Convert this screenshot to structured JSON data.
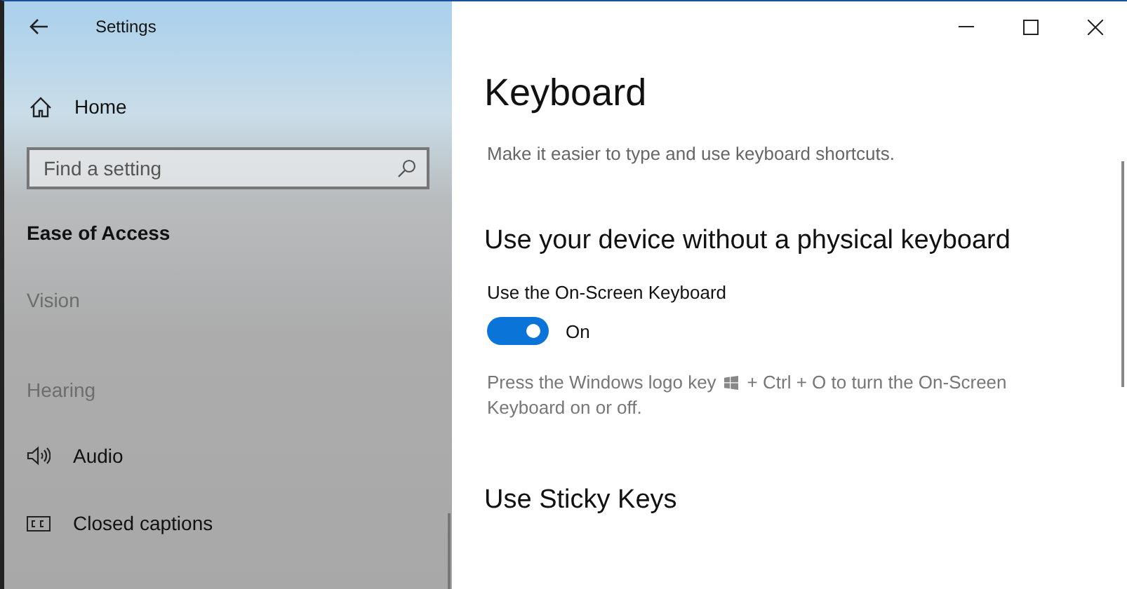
{
  "window": {
    "title": "Settings"
  },
  "sidebar": {
    "home": "Home",
    "search": {
      "placeholder": "Find a setting"
    },
    "section": "Ease of Access",
    "items": [
      {
        "kind": "header",
        "label": "Vision"
      },
      {
        "kind": "header",
        "label": "Hearing"
      },
      {
        "kind": "audio",
        "label": "Audio"
      },
      {
        "kind": "captions",
        "label": "Closed captions"
      }
    ]
  },
  "page": {
    "title": "Keyboard",
    "description": "Make it easier to type and use keyboard shortcuts.",
    "sections": [
      {
        "heading": "Use your device without a physical keyboard",
        "setting_label": "Use the On-Screen Keyboard",
        "toggle": {
          "on": true,
          "label": "On"
        },
        "hint_before": "Press the Windows logo key",
        "hint_after": "+ Ctrl + O to turn the On-Screen",
        "hint_line2": "Keyboard on or off."
      },
      {
        "heading": "Use Sticky Keys"
      }
    ]
  }
}
